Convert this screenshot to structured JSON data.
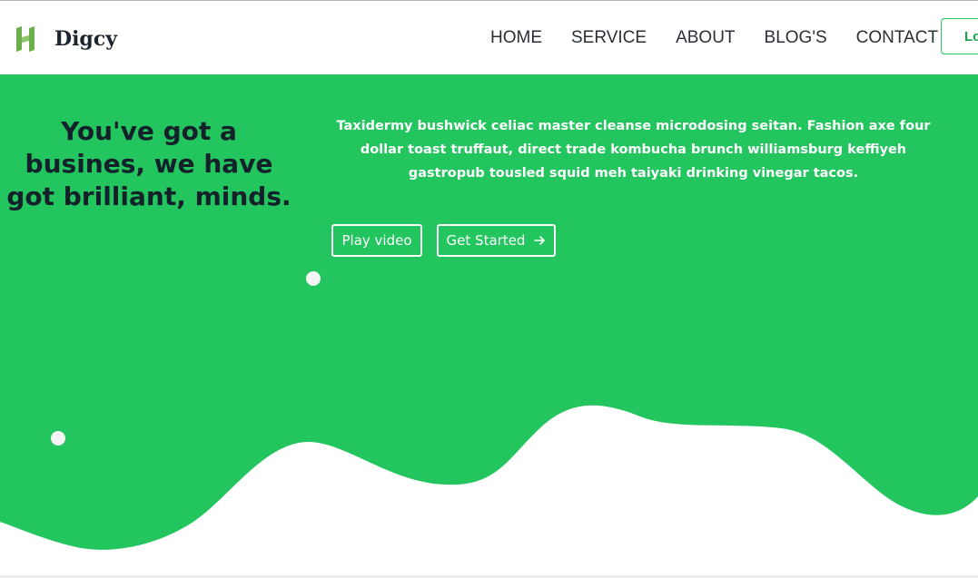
{
  "header": {
    "brand_name": "Digcy",
    "logo_icon": "h-logo-icon",
    "nav": [
      {
        "label": "HOME"
      },
      {
        "label": "SERVICE"
      },
      {
        "label": "ABOUT"
      },
      {
        "label": "BLOG'S"
      },
      {
        "label": "CONTACT"
      }
    ],
    "login_label": "Lo"
  },
  "hero": {
    "headline": "You've got a busines, we have got brilliant, minds.",
    "description": "Taxidermy bushwick celiac master cleanse microdosing seitan. Fashion axe four dollar toast truffaut, direct trade kombucha brunch williamsburg keffiyeh gastropub tousled squid meh taiyaki drinking vinegar tacos.",
    "play_video_label": "Play video",
    "get_started_label": "Get Started",
    "get_started_icon": "arrow-right-icon"
  },
  "colors": {
    "hero_green": "#22c55e",
    "logo_green": "#6ab04c",
    "headline_dark": "#14202a"
  }
}
